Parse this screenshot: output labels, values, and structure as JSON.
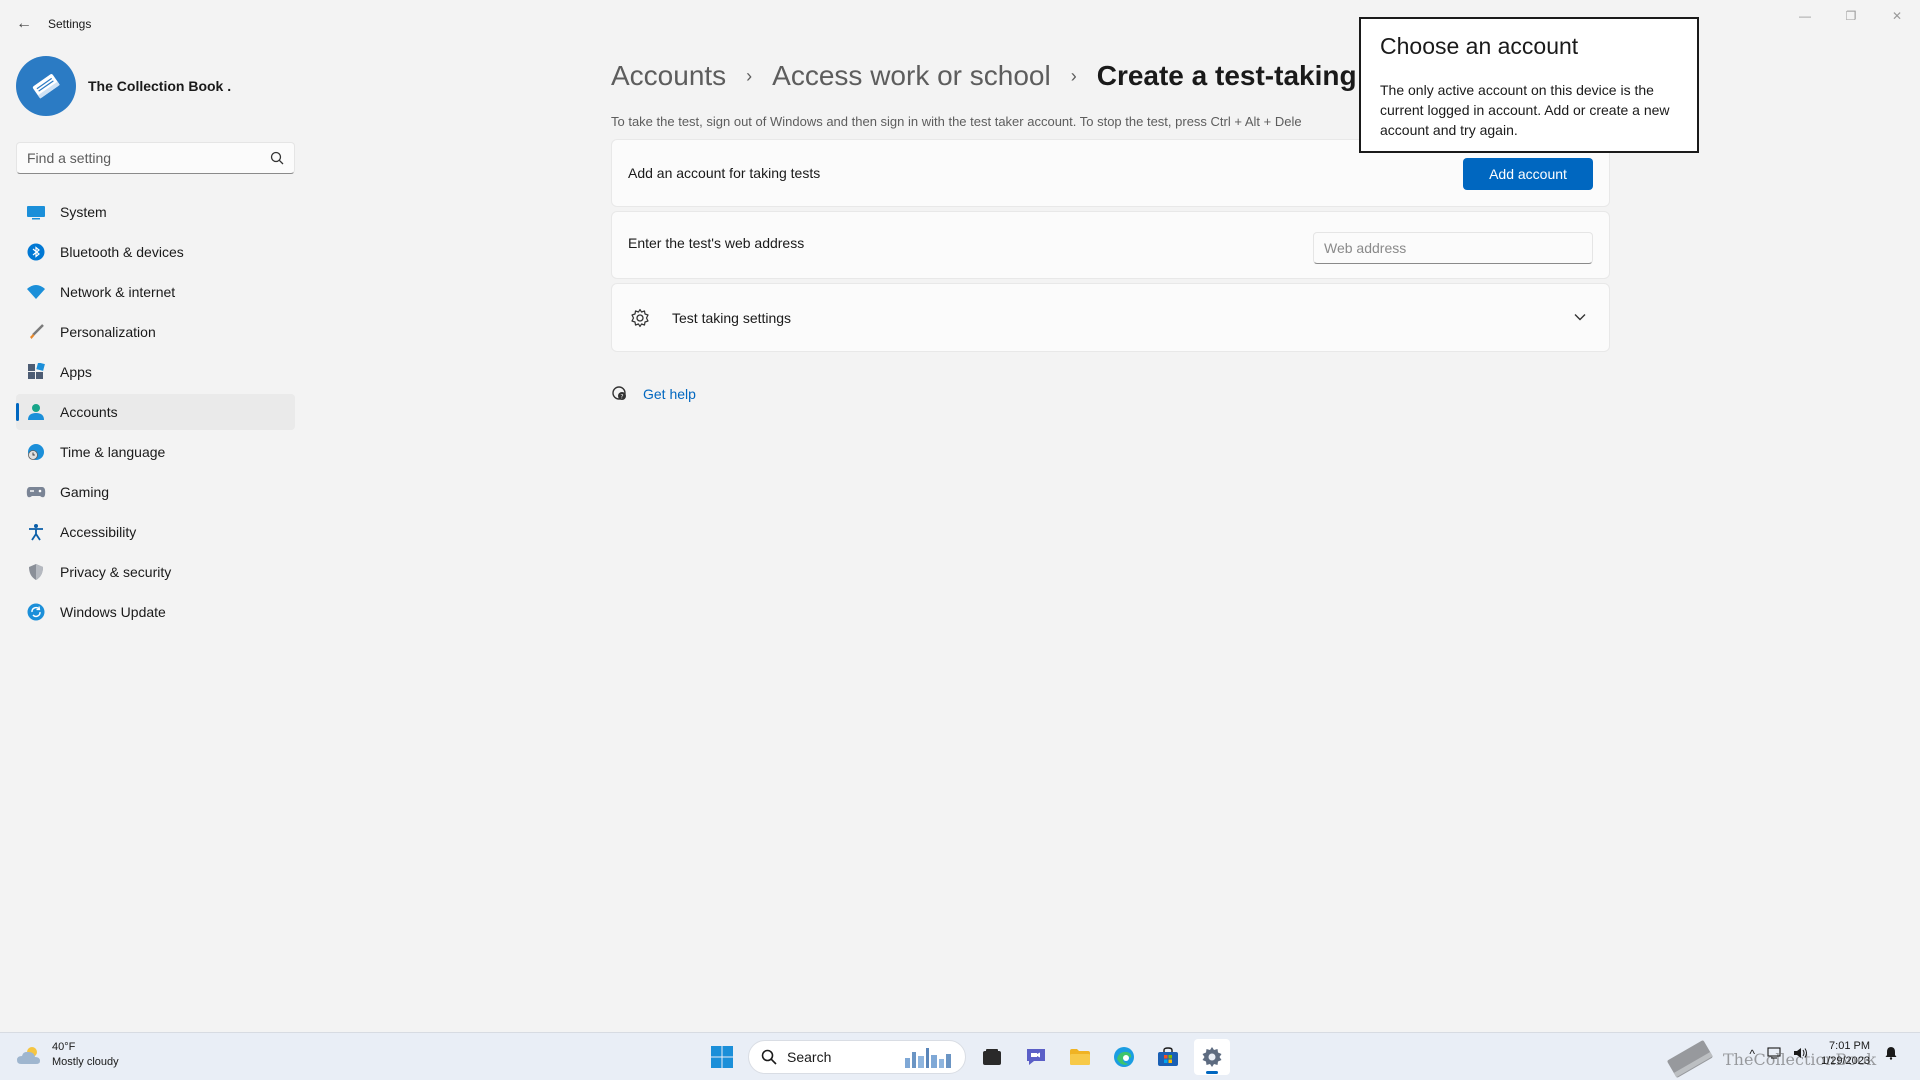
{
  "app": {
    "title": "Settings",
    "back_label": "←",
    "window_controls": {
      "minimize": "—",
      "restore": "❐",
      "close": "✕"
    }
  },
  "profile": {
    "name": "The Collection Book ."
  },
  "search": {
    "placeholder": "Find a setting"
  },
  "sidebar": {
    "items": [
      {
        "label": "System",
        "icon": "system-icon"
      },
      {
        "label": "Bluetooth & devices",
        "icon": "bluetooth-icon"
      },
      {
        "label": "Network & internet",
        "icon": "wifi-icon"
      },
      {
        "label": "Personalization",
        "icon": "brush-icon"
      },
      {
        "label": "Apps",
        "icon": "apps-icon"
      },
      {
        "label": "Accounts",
        "icon": "person-icon",
        "active": true
      },
      {
        "label": "Time & language",
        "icon": "globe-clock-icon"
      },
      {
        "label": "Gaming",
        "icon": "gamepad-icon"
      },
      {
        "label": "Accessibility",
        "icon": "accessibility-icon"
      },
      {
        "label": "Privacy & security",
        "icon": "shield-icon"
      },
      {
        "label": "Windows Update",
        "icon": "update-icon"
      }
    ]
  },
  "breadcrumb": {
    "items": [
      "Accounts",
      "Access work or school",
      "Create a test-taking a"
    ],
    "separator": "›"
  },
  "main": {
    "description": "To take the test, sign out of Windows and then sign in with the test taker account. To stop the test, press Ctrl + Alt + Dele",
    "add_account_card": {
      "label": "Add an account for taking tests",
      "button": "Add account"
    },
    "web_address_card": {
      "label": "Enter the test's web address",
      "placeholder": "Web address"
    },
    "settings_card": {
      "label": "Test taking settings"
    },
    "help_link": "Get help"
  },
  "dialog": {
    "title": "Choose an account",
    "body": "The only active account on this device is the current logged in account. Add or create a new account and try again."
  },
  "taskbar": {
    "weather": {
      "temp": "40°F",
      "condition": "Mostly cloudy"
    },
    "search_label": "Search",
    "clock": {
      "time": "7:01 PM",
      "date": "1/29/2023"
    },
    "watermark": "TheCollectionBook"
  },
  "colors": {
    "accent": "#0067c0",
    "background": "#f3f3f3",
    "card": "#fbfbfb"
  }
}
